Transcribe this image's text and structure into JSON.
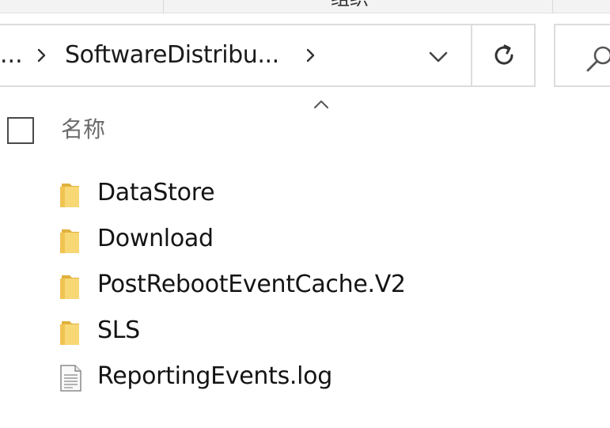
{
  "ribbon": {
    "cut_label": "组织"
  },
  "address_bar": {
    "overflow": "...",
    "current_folder": "SoftwareDistribu...",
    "dropdown_icon": "chevron-down-icon",
    "refresh_icon": "refresh-icon"
  },
  "search": {
    "icon": "search-icon"
  },
  "column_headers": {
    "name": "名称",
    "sort": "ascending"
  },
  "files": [
    {
      "name": "DataStore",
      "type": "folder"
    },
    {
      "name": "Download",
      "type": "folder"
    },
    {
      "name": "PostRebootEventCache.V2",
      "type": "folder"
    },
    {
      "name": "SLS",
      "type": "folder"
    },
    {
      "name": "ReportingEvents.log",
      "type": "file"
    }
  ],
  "colors": {
    "folder_yellow": "#f8d775",
    "folder_dark": "#e0b13e",
    "border": "#dcdcdc"
  }
}
